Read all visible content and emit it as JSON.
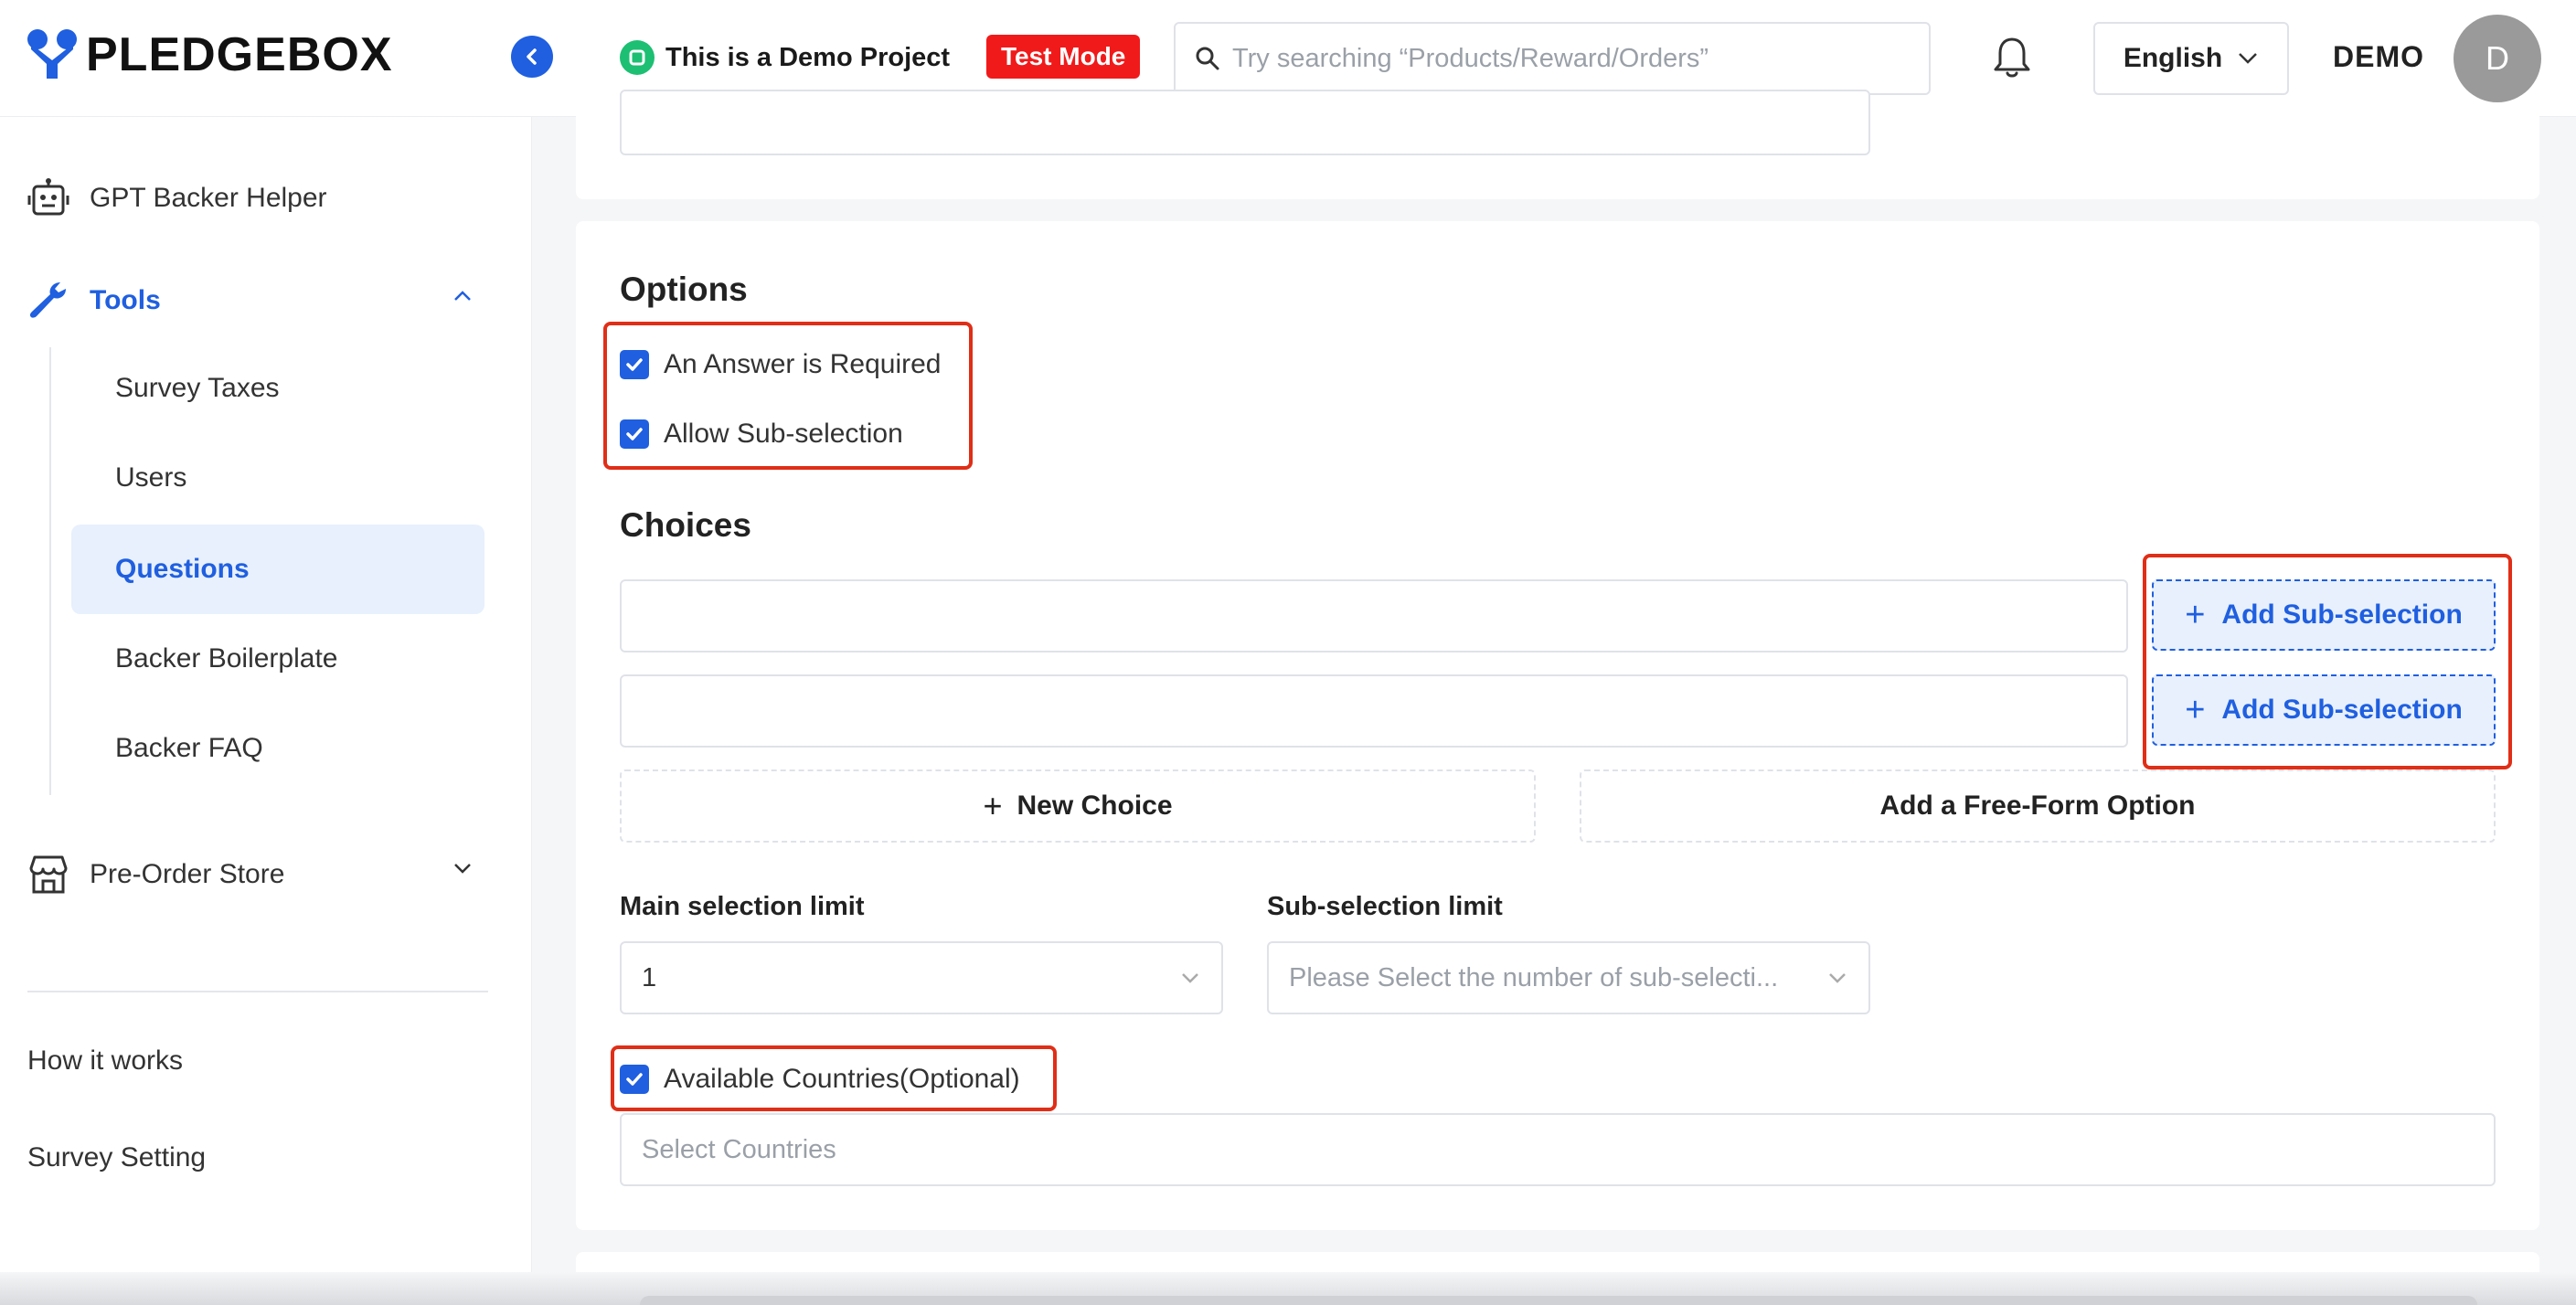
{
  "header": {
    "logo_text": "PLEDGEBOX",
    "project_title": "This is a Demo Project",
    "mode_badge": "Test Mode",
    "search_placeholder": "Try searching “Products/Reward/Orders”",
    "language": "English",
    "user_name": "DEMO",
    "avatar_initial": "D"
  },
  "sidebar": {
    "gpt_helper": "GPT Backer Helper",
    "tools_label": "Tools",
    "tools_items": [
      {
        "label": "Survey Taxes"
      },
      {
        "label": "Users"
      },
      {
        "label": "Questions",
        "active": true
      },
      {
        "label": "Backer Boilerplate"
      },
      {
        "label": "Backer FAQ"
      }
    ],
    "preorder_store": "Pre-Order Store",
    "how_it_works": "How it works",
    "survey_setting": "Survey Setting"
  },
  "options": {
    "title": "Options",
    "answer_required": {
      "label": "An Answer is Required",
      "checked": true
    },
    "allow_sub_selection": {
      "label": "Allow Sub-selection",
      "checked": true
    }
  },
  "choices": {
    "title": "Choices",
    "items": [
      {
        "value": "",
        "add_sub_label": "Add Sub-selection"
      },
      {
        "value": "",
        "add_sub_label": "Add Sub-selection"
      }
    ],
    "new_choice_label": "New Choice",
    "free_form_label": "Add a Free-Form Option"
  },
  "limits": {
    "main_label": "Main selection limit",
    "main_value": "1",
    "sub_label": "Sub-selection limit",
    "sub_placeholder": "Please Select the number of sub-selecti..."
  },
  "countries": {
    "label": "Available Countries(Optional)",
    "checked": true,
    "placeholder": "Select Countries"
  },
  "colors": {
    "accent": "#1f5fe0",
    "badge_red": "#f11a1a",
    "highlight_red": "#e02e17",
    "demo_green": "#1dbf73"
  }
}
